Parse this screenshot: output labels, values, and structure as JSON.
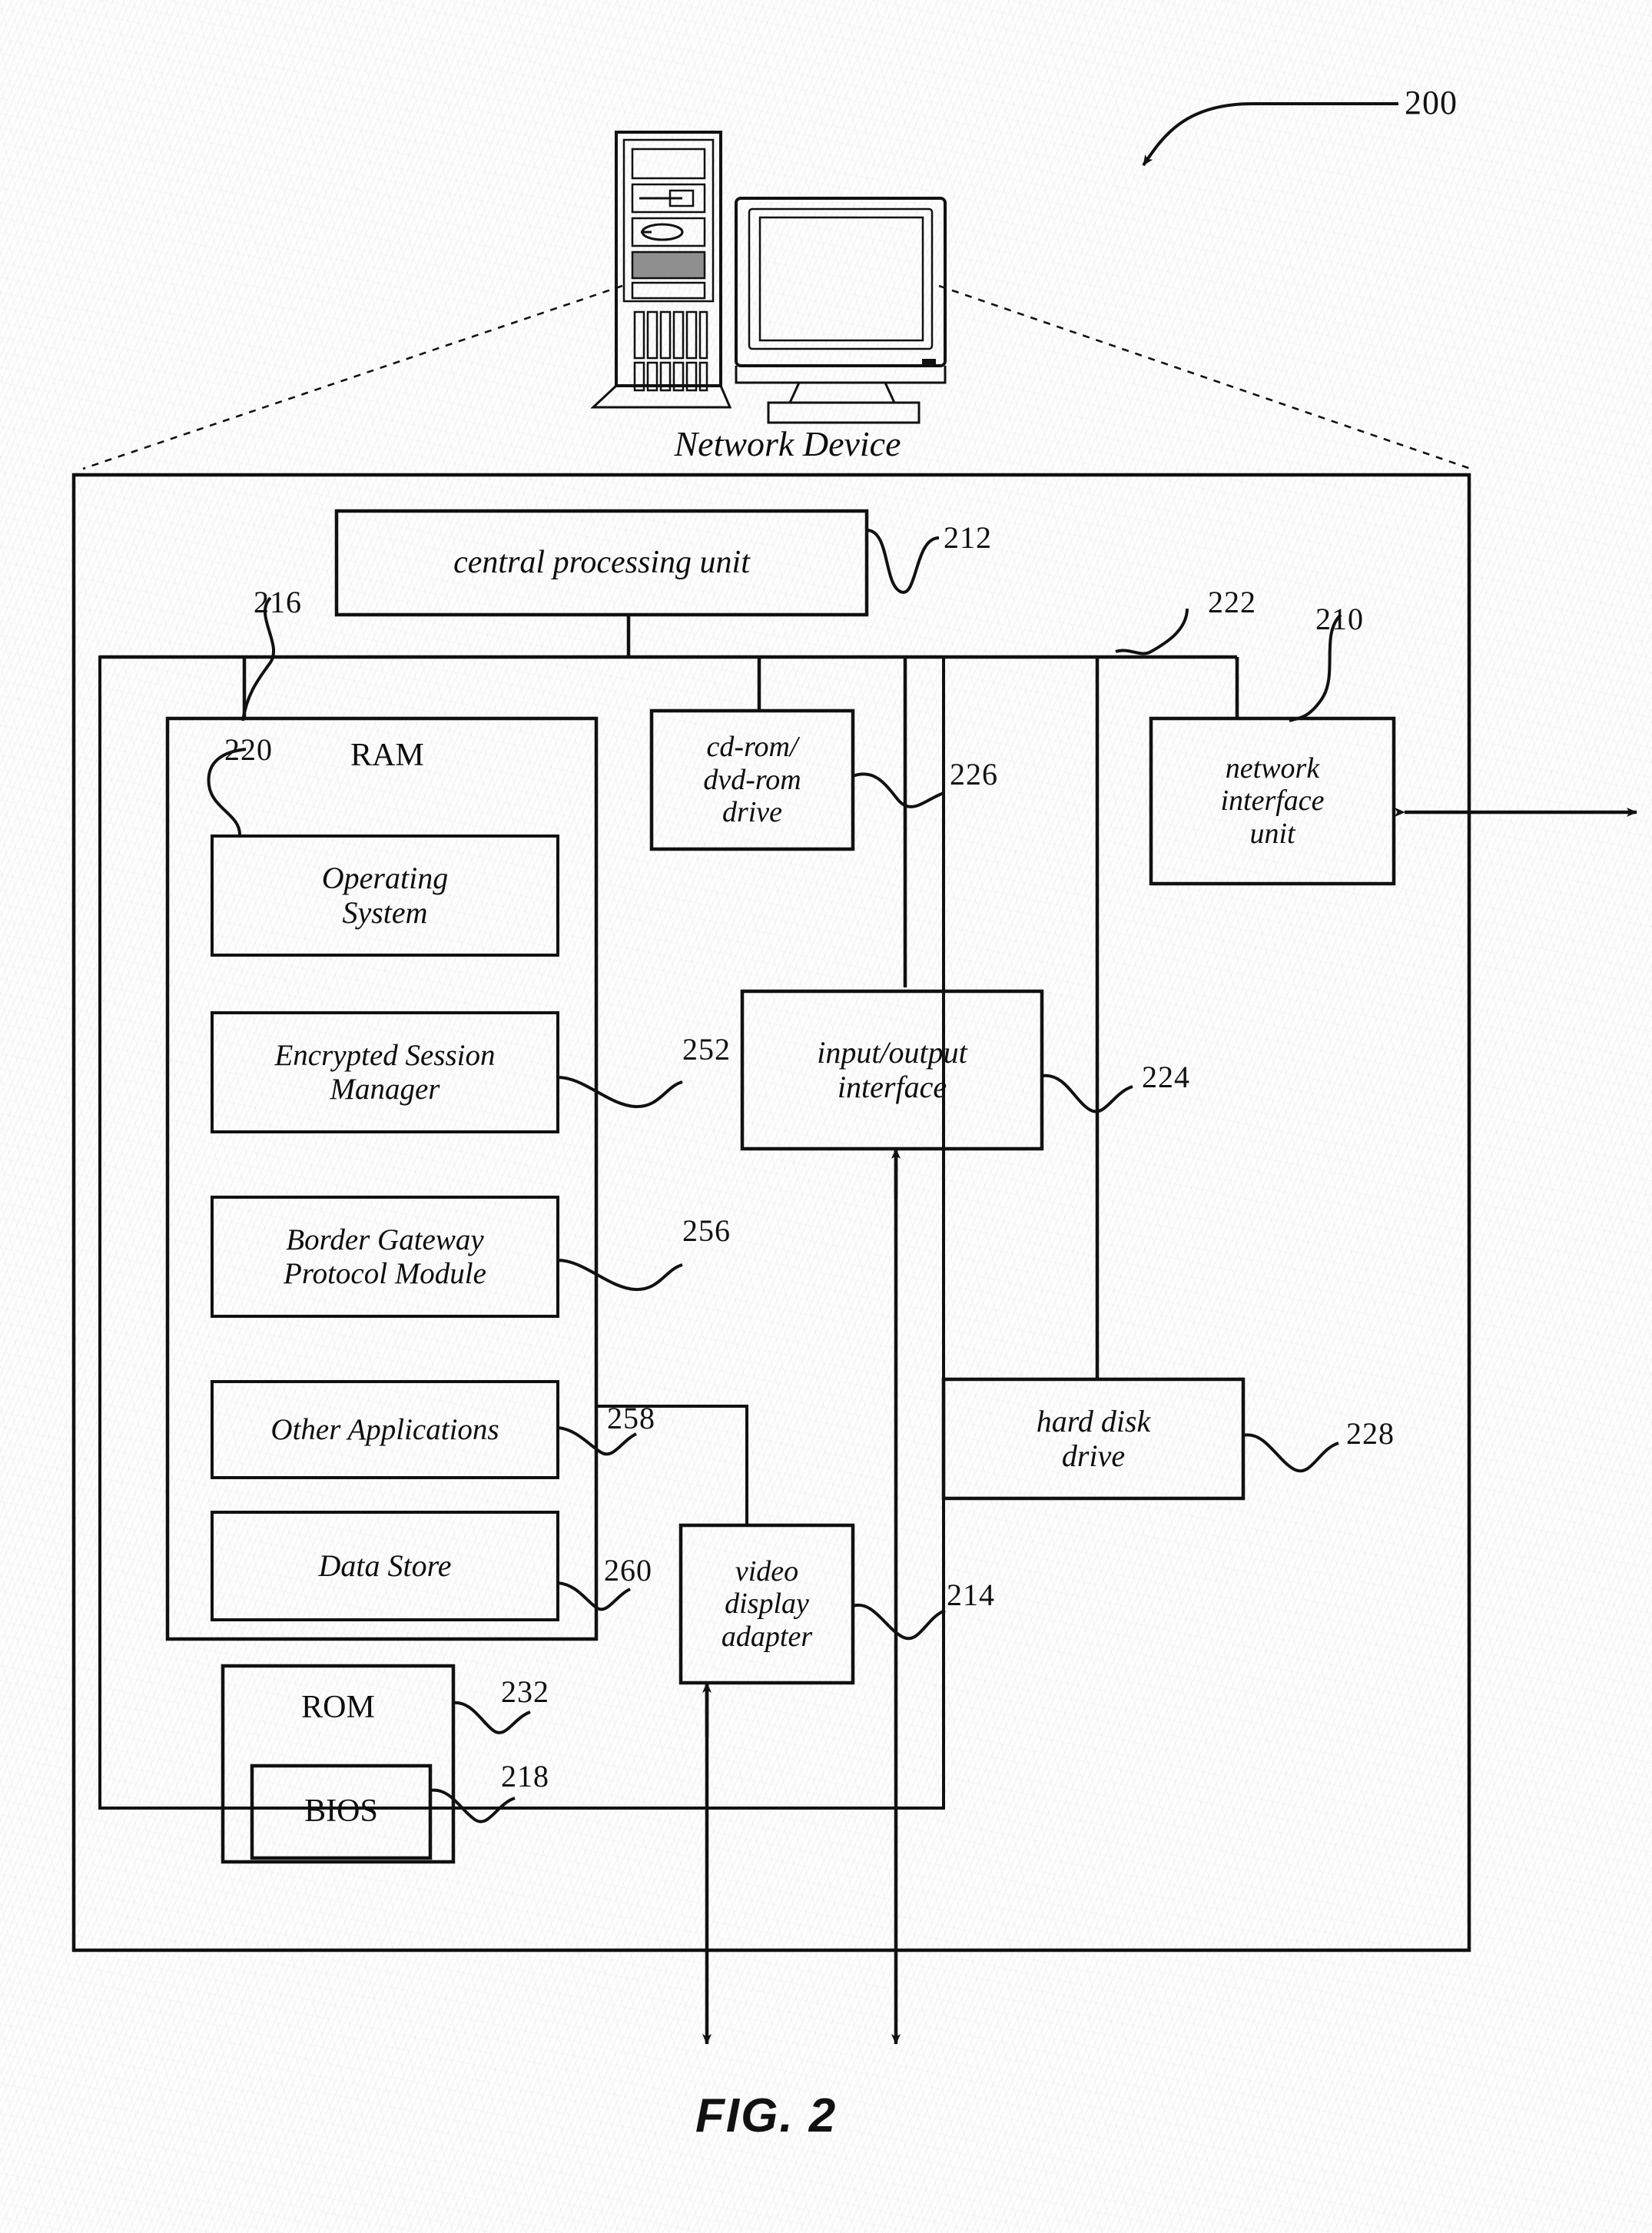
{
  "figure": {
    "caption": "FIG. 2",
    "top_reference": "200",
    "device_label": "Network  Device"
  },
  "reference_numerals": {
    "figure": "200",
    "system_bus": "210",
    "cpu": "212",
    "video_display_adapter": "214",
    "memory": "216",
    "bios": "218",
    "ram": "220",
    "bus_right": "222",
    "io_interface": "224",
    "cd_dvd_drive": "226",
    "hard_disk_drive": "228",
    "rom": "232",
    "encrypted_session_manager": "252",
    "border_gateway_protocol_module": "256",
    "other_applications": "258",
    "data_store": "260"
  },
  "blocks": {
    "cpu": "central processing unit",
    "ram_title": "RAM",
    "operating_system": "Operating\nSystem",
    "encrypted_session_manager": "Encrypted Session\nManager",
    "border_gateway_protocol_module": "Border Gateway\nProtocol Module",
    "other_applications": "Other Applications",
    "data_store": "Data Store",
    "rom": "ROM",
    "bios": "BIOS",
    "cd_dvd_drive": "cd-rom/\ndvd-rom\ndrive",
    "network_interface_unit": "network\ninterface\nunit",
    "io_interface": "input/output\ninterface",
    "hard_disk_drive": "hard disk\ndrive",
    "video_display_adapter": "video\ndisplay\nadapter"
  },
  "colors": {
    "ink": "#111111",
    "paper": "#fdfdfd"
  }
}
